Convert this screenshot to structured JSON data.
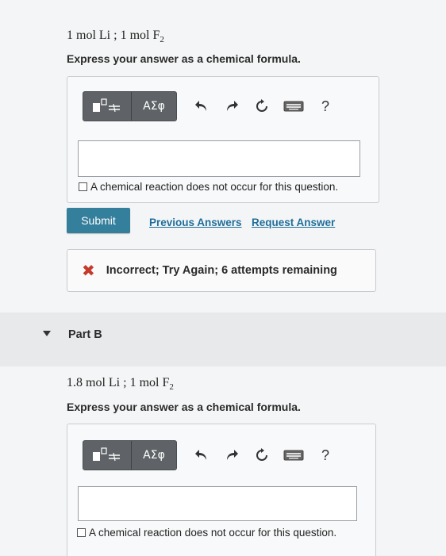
{
  "part_a": {
    "reactants": {
      "li_amount": "1",
      "li_unit": "mol",
      "li_species": "Li",
      "separator": ";",
      "f_amount": "1",
      "f_unit": "mol",
      "f_species": "F",
      "f_subscript": "2"
    },
    "instruction": "Express your answer as a chemical formula.",
    "toolbar": {
      "templates_icon": "templates-icon",
      "symbols_label": "ΑΣφ",
      "undo_icon": "undo-icon",
      "redo_icon": "redo-icon",
      "reset_icon": "reset-icon",
      "keyboard_icon": "keyboard-icon",
      "help_label": "?"
    },
    "answer_value": "",
    "no_reaction_label": "A chemical reaction does not occur for this question.",
    "submit_label": "Submit",
    "previous_answers_label": "Previous Answers",
    "request_answer_label": "Request Answer",
    "feedback": {
      "icon": "error-x-icon",
      "text": "Incorrect; Try Again; 6 attempts remaining"
    }
  },
  "part_b": {
    "title": "Part B",
    "reactants": {
      "li_amount": "1.8",
      "li_unit": "mol",
      "li_species": "Li",
      "separator": ";",
      "f_amount": "1",
      "f_unit": "mol",
      "f_species": "F",
      "f_subscript": "2"
    },
    "instruction": "Express your answer as a chemical formula.",
    "toolbar": {
      "templates_icon": "templates-icon",
      "symbols_label": "ΑΣφ",
      "undo_icon": "undo-icon",
      "redo_icon": "redo-icon",
      "reset_icon": "reset-icon",
      "keyboard_icon": "keyboard-icon",
      "help_label": "?"
    },
    "answer_value": "",
    "no_reaction_label": "A chemical reaction does not occur for this question."
  },
  "colors": {
    "submit": "#347f9b",
    "link": "#1f6e9a",
    "error": "#c53a2d",
    "toolbar": "#5f6367"
  }
}
